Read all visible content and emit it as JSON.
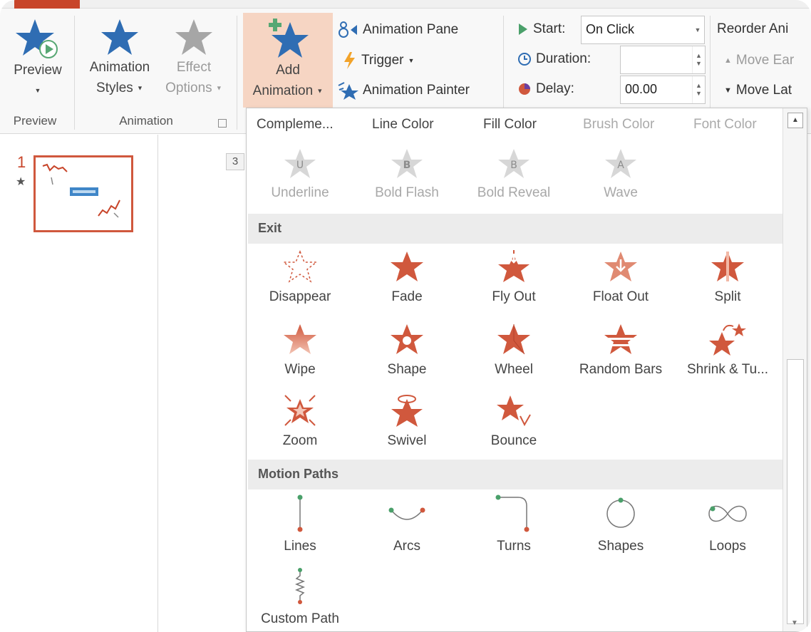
{
  "ribbon": {
    "preview_group": {
      "preview_button": "Preview",
      "group_label": "Preview"
    },
    "animation_group": {
      "styles_line1": "Animation",
      "styles_line2": "Styles",
      "effect_line1": "Effect",
      "effect_line2": "Options",
      "group_label": "Animation"
    },
    "advanced_group": {
      "add_line1": "Add",
      "add_line2": "Animation",
      "animation_pane": "Animation Pane",
      "trigger": "Trigger",
      "animation_painter": "Animation Painter"
    },
    "timing_group": {
      "start_label": "Start:",
      "start_value": "On Click",
      "duration_label": "Duration:",
      "duration_value": "",
      "delay_label": "Delay:",
      "delay_value": "00.00",
      "reorder_label": "Reorder Ani",
      "move_earlier": "Move Ear",
      "move_later": "Move Lat"
    }
  },
  "slide_pane": {
    "slide_number": "1",
    "mid_tag": "3"
  },
  "gallery": {
    "top_row": {
      "items": [
        {
          "label": "Compleme...",
          "enabled": true
        },
        {
          "label": "Line Color",
          "enabled": true
        },
        {
          "label": "Fill Color",
          "enabled": true
        },
        {
          "label": "Brush Color",
          "enabled": false
        },
        {
          "label": "Font Color",
          "enabled": false
        }
      ]
    },
    "emphasis_text": {
      "items": [
        {
          "label": "Underline",
          "letter": "U"
        },
        {
          "label": "Bold Flash",
          "letter": "B"
        },
        {
          "label": "Bold Reveal",
          "letter": "B"
        },
        {
          "label": "Wave",
          "letter": "A"
        }
      ]
    },
    "exit": {
      "header": "Exit",
      "items": [
        {
          "label": "Disappear",
          "icon": "disappear-icon"
        },
        {
          "label": "Fade",
          "icon": "fade-icon"
        },
        {
          "label": "Fly Out",
          "icon": "fly-out-icon"
        },
        {
          "label": "Float Out",
          "icon": "float-out-icon"
        },
        {
          "label": "Split",
          "icon": "split-icon"
        },
        {
          "label": "Wipe",
          "icon": "wipe-icon"
        },
        {
          "label": "Shape",
          "icon": "shape-icon"
        },
        {
          "label": "Wheel",
          "icon": "wheel-icon"
        },
        {
          "label": "Random Bars",
          "icon": "random-bars-icon"
        },
        {
          "label": "Shrink & Tu...",
          "icon": "shrink-turn-icon"
        },
        {
          "label": "Zoom",
          "icon": "zoom-icon"
        },
        {
          "label": "Swivel",
          "icon": "swivel-icon"
        },
        {
          "label": "Bounce",
          "icon": "bounce-icon"
        }
      ]
    },
    "motion_paths": {
      "header": "Motion Paths",
      "items": [
        {
          "label": "Lines",
          "icon": "lines-path-icon"
        },
        {
          "label": "Arcs",
          "icon": "arcs-path-icon"
        },
        {
          "label": "Turns",
          "icon": "turns-path-icon"
        },
        {
          "label": "Shapes",
          "icon": "shapes-path-icon"
        },
        {
          "label": "Loops",
          "icon": "loops-path-icon"
        },
        {
          "label": "Custom Path",
          "icon": "custom-path-icon"
        }
      ]
    }
  },
  "colors": {
    "accent": "#c8452a",
    "add_animation_bg": "#f6d5c3",
    "star_blue": "#2f6db3",
    "exit_red": "#d0583d"
  }
}
